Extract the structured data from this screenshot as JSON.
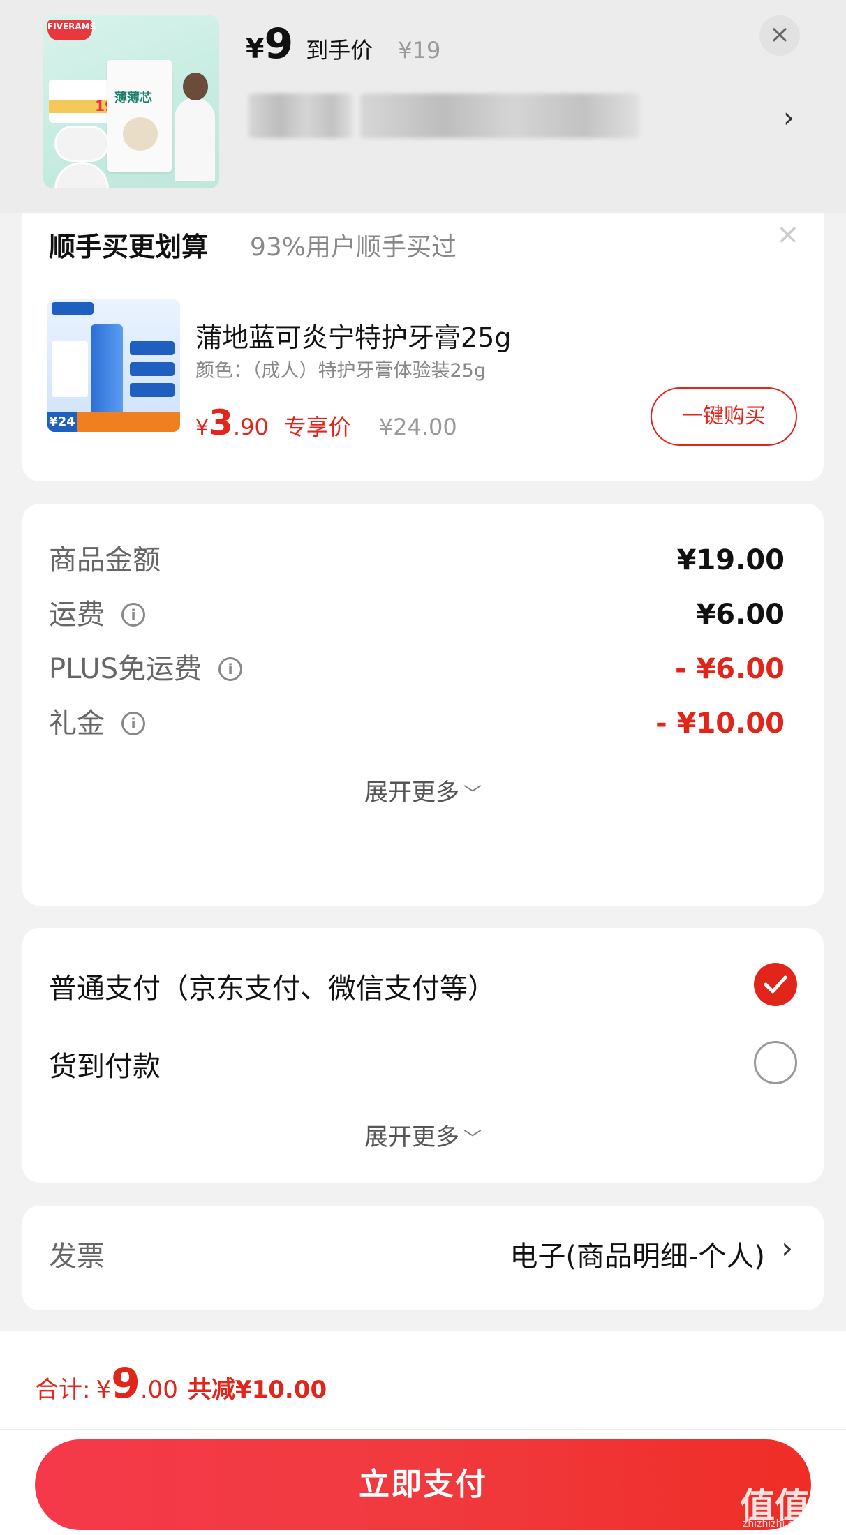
{
  "header": {
    "product_image_alt": "product-thumbnail",
    "thumb_brand": "FIVERAMS",
    "thumb_box_title": "薄薄芯",
    "thumb_price_tag": "19",
    "price_symbol": "¥",
    "price_integer": "9",
    "price_label": "到手价",
    "original_price": "¥19",
    "close_icon": "close-icon",
    "chevron_icon": "chevron-right-icon"
  },
  "addon": {
    "title": "顺手买更划算",
    "subtitle": "93%用户顺手买过",
    "close_icon": "close-icon",
    "product_name": "蒲地蓝可炎宁特护牙膏25g",
    "product_spec": "颜色：（成人）特护牙膏体验装25g",
    "price_symbol": "¥",
    "price_integer": "3",
    "price_decimal": ".90",
    "price_tag": "专享价",
    "original_price": "¥24.00",
    "badge": "¥24",
    "buy_button": "一键购买"
  },
  "amounts": {
    "rows": [
      {
        "label": "商品金额",
        "value": "¥19.00",
        "info": false,
        "highlight": false
      },
      {
        "label": "运费",
        "value": "¥6.00",
        "info": true,
        "highlight": false
      },
      {
        "label": "PLUS免运费",
        "value": "- ¥6.00",
        "info": true,
        "highlight": true
      },
      {
        "label": "礼金",
        "value": "- ¥10.00",
        "info": true,
        "highlight": true
      }
    ],
    "expand_label": "展开更多",
    "info_icon": "info-icon"
  },
  "payment": {
    "options": [
      {
        "label": "普通支付（京东支付、微信支付等）",
        "selected": true
      },
      {
        "label": "货到付款",
        "selected": false
      }
    ],
    "expand_label": "展开更多"
  },
  "invoice": {
    "label": "发票",
    "value": "电子(商品明细-个人)",
    "chevron_icon": "chevron-right-icon"
  },
  "bottom": {
    "total_label": "合计:",
    "total_symbol": "¥",
    "total_integer": "9",
    "total_decimal": ".00",
    "saved": "共减¥10.00",
    "pay_button": "立即支付"
  },
  "watermark": {
    "text": "值值值",
    "site": "zhizhizhi.com"
  },
  "colors": {
    "accent": "#e1251b",
    "page_bg": "#f2f2f2",
    "header_bg": "#ececec"
  }
}
